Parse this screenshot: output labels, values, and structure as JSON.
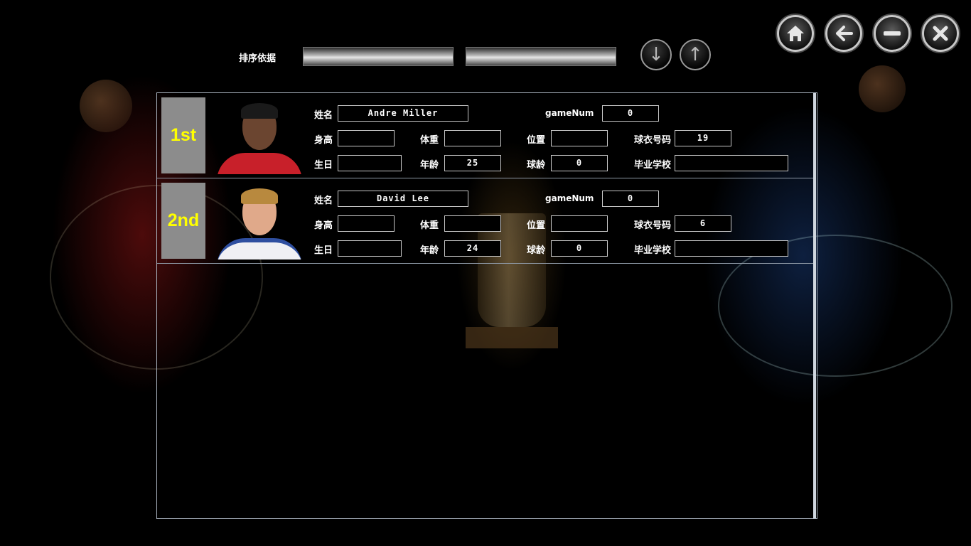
{
  "sort": {
    "label": "排序依据",
    "field1_value": "",
    "field2_value": ""
  },
  "buttons": {
    "descending_icon": "arrow-down-icon",
    "ascending_icon": "arrow-up-icon"
  },
  "window_controls": [
    "home-icon",
    "back-icon",
    "minimize-icon",
    "close-icon"
  ],
  "field_labels": {
    "name": "姓名",
    "game_num": "gameNum",
    "height": "身高",
    "weight": "体重",
    "position": "位置",
    "jersey": "球衣号码",
    "birthday": "生日",
    "age": "年龄",
    "experience": "球龄",
    "school": "毕业学校"
  },
  "players": [
    {
      "rank": "1st",
      "name": "Andre Miller",
      "game_num": "0",
      "height": "",
      "weight": "",
      "position": "",
      "jersey": "19",
      "birthday": "",
      "age": "25",
      "experience": "0",
      "school": ""
    },
    {
      "rank": "2nd",
      "name": "David Lee",
      "game_num": "0",
      "height": "",
      "weight": "",
      "position": "",
      "jersey": "6",
      "birthday": "",
      "age": "24",
      "experience": "0",
      "school": ""
    }
  ],
  "colors": {
    "rank_text": "#ffff00",
    "rank_bg": "#8c8c8c",
    "panel_border": "#aab4c0"
  }
}
